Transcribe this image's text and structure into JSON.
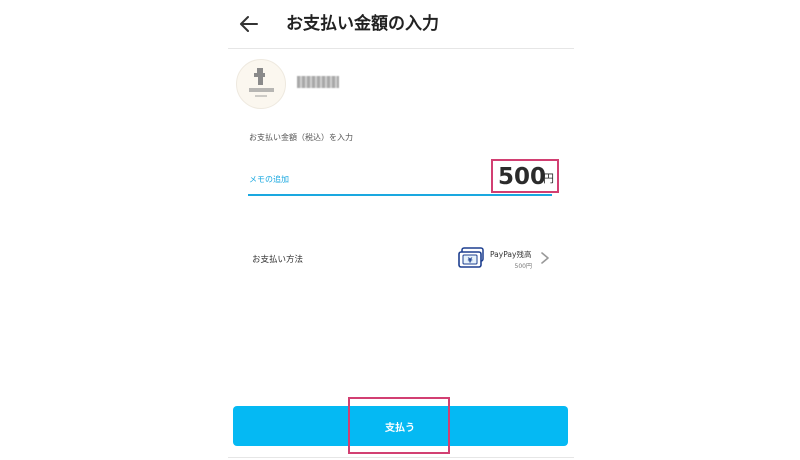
{
  "header": {
    "back_icon": "arrow-left-icon",
    "title": "お支払い金額の入力"
  },
  "merchant": {
    "avatar_icon": "store-logo-icon",
    "name_obscured": true
  },
  "amount": {
    "label": "お支払い金額（税込）を入力",
    "memo_link": "メモの追加",
    "value": "500",
    "unit": "円",
    "highlight_color": "#d23f72",
    "accent_color": "#1aa8e0"
  },
  "payment_method": {
    "label": "お支払い方法",
    "method_icon": "paypay-wallet-icon",
    "method_name": "PayPay残高",
    "balance": "500円",
    "chevron_icon": "chevron-right-icon"
  },
  "pay_button": {
    "label": "支払う",
    "color": "#05b9f3"
  }
}
